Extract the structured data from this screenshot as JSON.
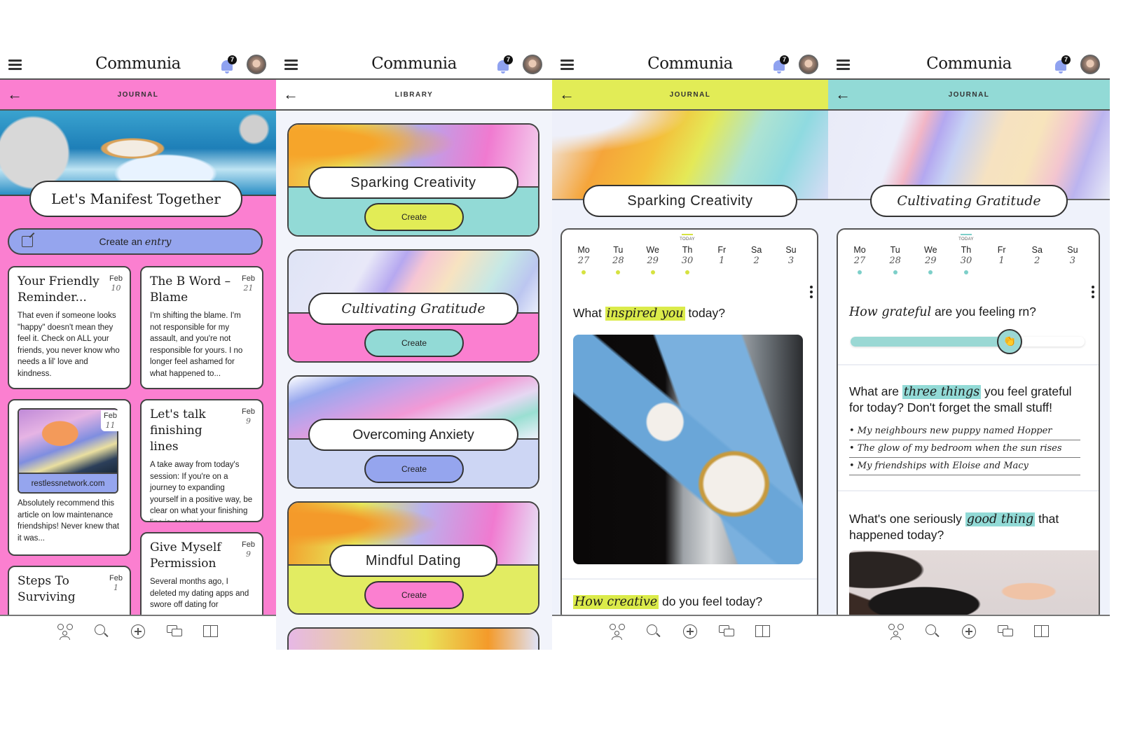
{
  "app": {
    "logo": "Communia",
    "notification_count": "7"
  },
  "screens": [
    {
      "subheader": "JOURNAL",
      "hero_title": "Let's Manifest Together",
      "create_entry": {
        "prefix": "Create an ",
        "emphasis": "entry"
      },
      "entries": [
        {
          "title": "Your Friendly Reminder...",
          "month": "Feb",
          "day": "10",
          "body": "That even if someone looks \"happy\" doesn't mean they feel it. Check on ALL your friends, you never know who needs a lil' love and kindness."
        },
        {
          "title": "The B Word – Blame",
          "month": "Feb",
          "day": "21",
          "body": "I'm shifting the blame. I'm not responsible for my assault, and you're not responsible for yours.  I no longer feel ashamed for what happened to..."
        },
        {
          "month": "Feb",
          "day": "11",
          "link": "restlessnetwork.com",
          "body": "Absolutely recommend this article on low maintenance friendships! Never knew that it was..."
        },
        {
          "title": "Let's talk finishing lines",
          "month": "Feb",
          "day": "9",
          "body": "A take away from today's session: If you're on a journey to expanding yourself in a positive way, be clear on what your finishing line is, to avoid..."
        },
        {
          "title": "Steps To Surviving",
          "month": "Feb",
          "day": "1",
          "body": ""
        },
        {
          "title": "Give Myself Permission",
          "month": "Feb",
          "day": "9",
          "body": "Several months ago, I deleted my dating apps and swore off dating for"
        }
      ]
    },
    {
      "subheader": "LIBRARY",
      "create_label": "Create",
      "prompts": [
        {
          "title": "Sparking Creativity",
          "band_color": "#92dad6",
          "button_color": "#e2ec56"
        },
        {
          "title": "Cultivating Gratitude",
          "band_color": "#fb7fd0",
          "button_color": "#92dad6"
        },
        {
          "title": "Overcoming Anxiety",
          "band_color": "#cdd6f4",
          "button_color": "#95a5ee"
        },
        {
          "title": "Mindful Dating",
          "band_color": "#e2ec62",
          "button_color": "#fb7fd0"
        }
      ]
    },
    {
      "subheader": "JOURNAL",
      "title": "Sparking Creativity",
      "today_label": "TODAY",
      "week": [
        {
          "dn": "Mo",
          "dd": "27",
          "done": true
        },
        {
          "dn": "Tu",
          "dd": "28",
          "done": true
        },
        {
          "dn": "We",
          "dd": "29",
          "done": true
        },
        {
          "dn": "Th",
          "dd": "30",
          "done": true,
          "today": true
        },
        {
          "dn": "Fr",
          "dd": "1",
          "done": false
        },
        {
          "dn": "Sa",
          "dd": "2",
          "done": false
        },
        {
          "dn": "Su",
          "dd": "3",
          "done": false
        }
      ],
      "q1": {
        "pre": "What ",
        "hl": "inspired you",
        "post": " today?"
      },
      "q2": {
        "pre": "",
        "hl": "How creative",
        "post": " do you feel today?"
      }
    },
    {
      "subheader": "JOURNAL",
      "title": "Cultivating Gratitude",
      "today_label": "TODAY",
      "week": [
        {
          "dn": "Mo",
          "dd": "27",
          "done": true
        },
        {
          "dn": "Tu",
          "dd": "28",
          "done": true
        },
        {
          "dn": "We",
          "dd": "29",
          "done": true
        },
        {
          "dn": "Th",
          "dd": "30",
          "done": true,
          "today": true
        },
        {
          "dn": "Fr",
          "dd": "1",
          "done": false
        },
        {
          "dn": "Sa",
          "dd": "2",
          "done": false
        },
        {
          "dn": "Su",
          "dd": "3",
          "done": false
        }
      ],
      "q1": {
        "pre": "",
        "hl": "How grateful",
        "post": " are you feeling rn?"
      },
      "slider_value": 0.68,
      "q2": {
        "pre": "What are ",
        "hl": "three things",
        "post": " you feel grateful for today? Don't forget the small stuff!"
      },
      "gratitude_items": [
        "• My neighbours new  puppy named Hopper",
        "• The glow of my bedroom when the sun rises",
        "• My friendships with Eloise and Macy"
      ],
      "q3": {
        "pre": "What's one seriously ",
        "hl": "good thing",
        "post": " that happened today?"
      }
    }
  ]
}
